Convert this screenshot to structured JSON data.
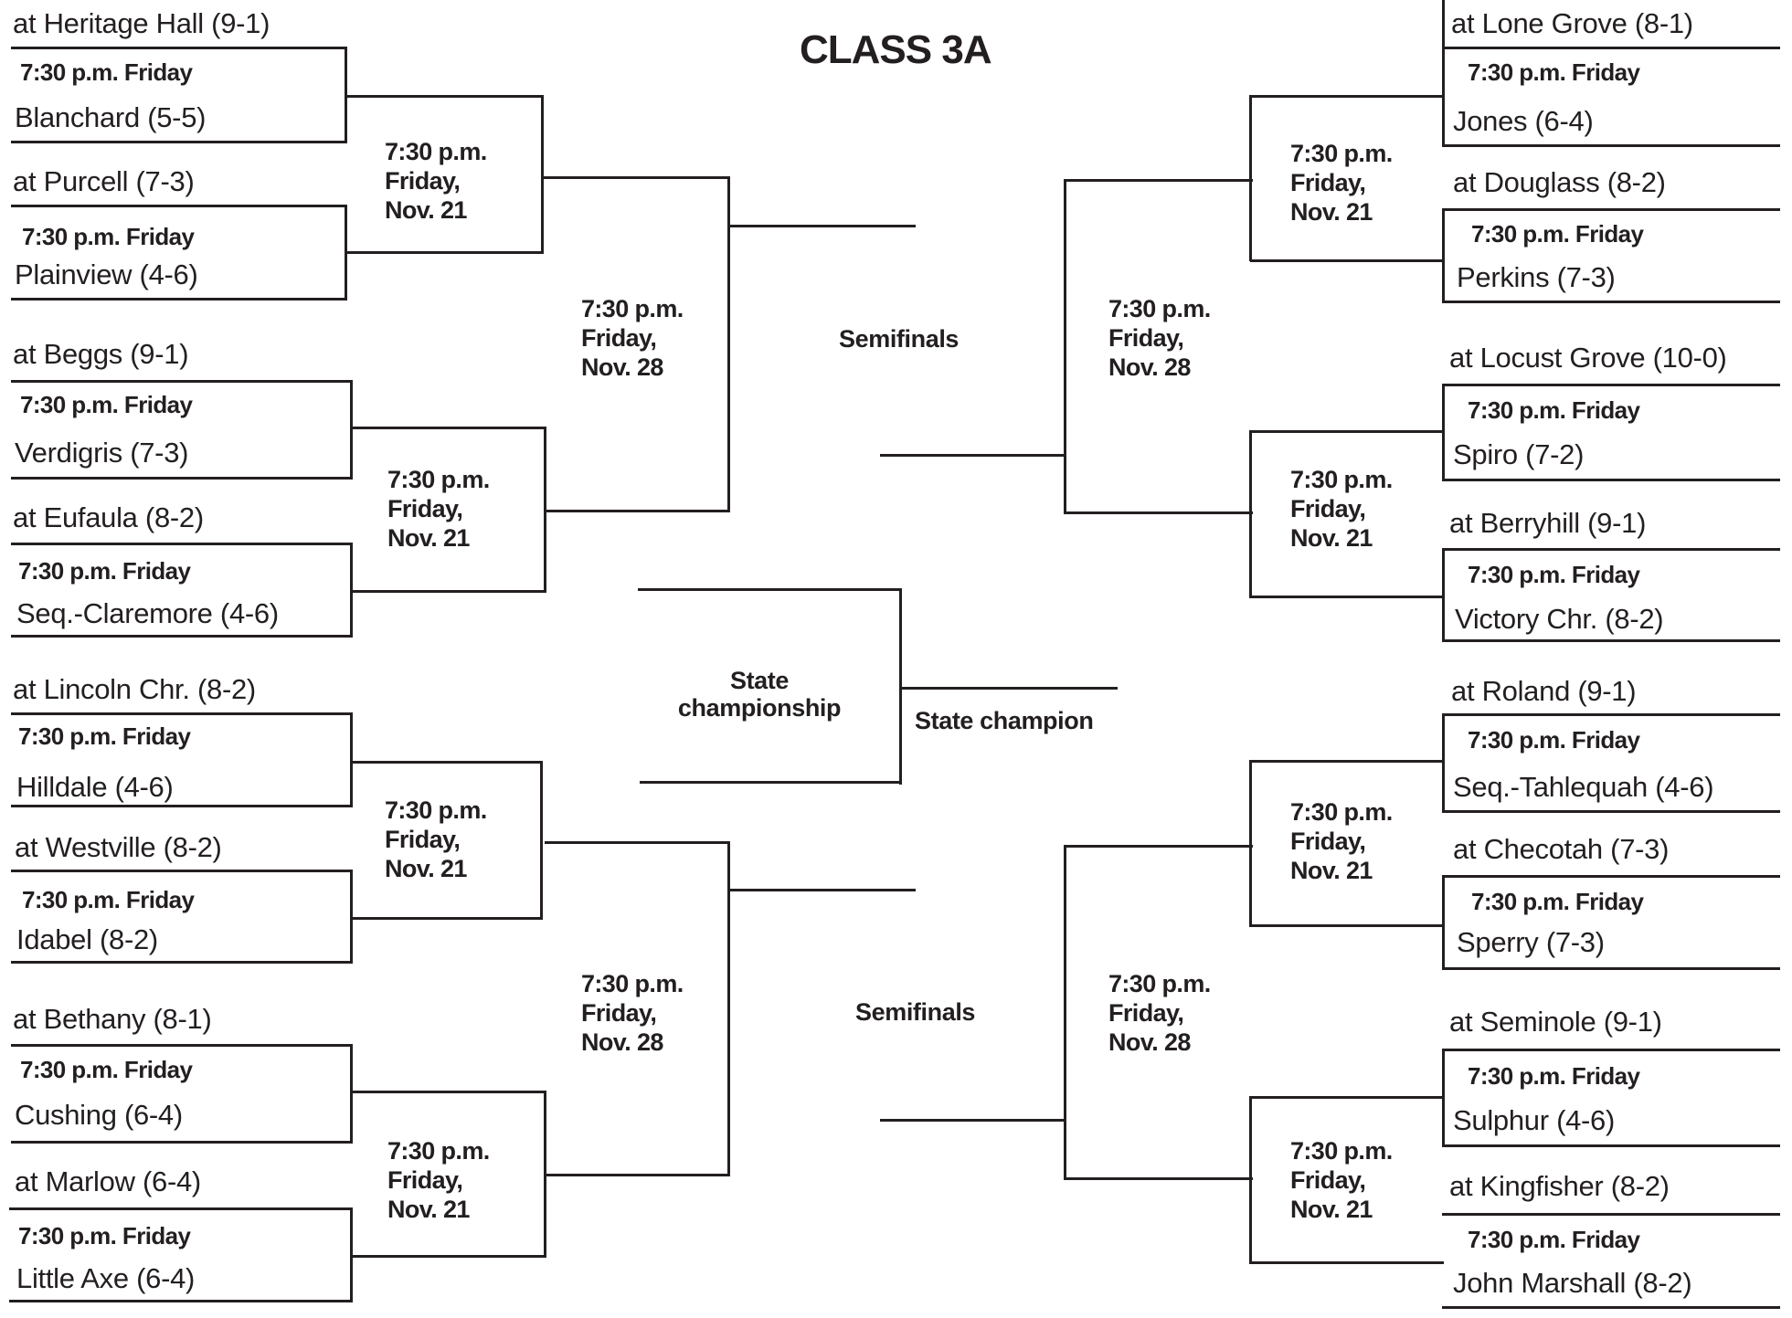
{
  "title": "CLASS 3A",
  "first_round_time": "7:30 p.m. Friday",
  "quarterfinal_schedule": [
    "7:30 p.m.",
    "Friday,",
    "Nov. 21"
  ],
  "semifinal_schedule": [
    "7:30 p.m.",
    "Friday,",
    "Nov. 28"
  ],
  "labels": {
    "semifinals": "Semifinals",
    "state_championship": [
      "State",
      "championship"
    ],
    "state_champion": "State champion"
  },
  "left_games": [
    {
      "host": "at Heritage Hall (9-1)",
      "time": "7:30 p.m. Friday",
      "visitor": "Blanchard (5-5)"
    },
    {
      "host": "at Purcell (7-3)",
      "time": "7:30 p.m. Friday",
      "visitor": "Plainview (4-6)"
    },
    {
      "host": "at Beggs (9-1)",
      "time": "7:30 p.m. Friday",
      "visitor": "Verdigris (7-3)"
    },
    {
      "host": "at Eufaula (8-2)",
      "time": "7:30 p.m. Friday",
      "visitor": "Seq.-Claremore (4-6)"
    },
    {
      "host": "at Lincoln Chr. (8-2)",
      "time": "7:30 p.m. Friday",
      "visitor": "Hilldale (4-6)"
    },
    {
      "host": "at Westville (8-2)",
      "time": "7:30 p.m. Friday",
      "visitor": "Idabel (8-2)"
    },
    {
      "host": "at Bethany (8-1)",
      "time": "7:30 p.m. Friday",
      "visitor": "Cushing (6-4)"
    },
    {
      "host": "at Marlow (6-4)",
      "time": "7:30 p.m. Friday",
      "visitor": "Little Axe (6-4)"
    }
  ],
  "right_games": [
    {
      "host": "at Lone Grove (8-1)",
      "time": "7:30 p.m. Friday",
      "visitor": "Jones (6-4)"
    },
    {
      "host": "at Douglass (8-2)",
      "time": "7:30 p.m. Friday",
      "visitor": "Perkins (7-3)"
    },
    {
      "host": "at Locust Grove (10-0)",
      "time": "7:30 p.m. Friday",
      "visitor": "Spiro (7-2)"
    },
    {
      "host": "at Berryhill (9-1)",
      "time": "7:30 p.m. Friday",
      "visitor": "Victory Chr. (8-2)"
    },
    {
      "host": "at Roland (9-1)",
      "time": "7:30 p.m. Friday",
      "visitor": "Seq.-Tahlequah (4-6)"
    },
    {
      "host": "at Checotah (7-3)",
      "time": "7:30 p.m. Friday",
      "visitor": "Sperry (7-3)"
    },
    {
      "host": "at Seminole (9-1)",
      "time": "7:30 p.m. Friday",
      "visitor": "Sulphur (4-6)"
    },
    {
      "host": "at Kingfisher (8-2)",
      "time": "7:30 p.m. Friday",
      "visitor": "John Marshall (8-2)"
    }
  ]
}
